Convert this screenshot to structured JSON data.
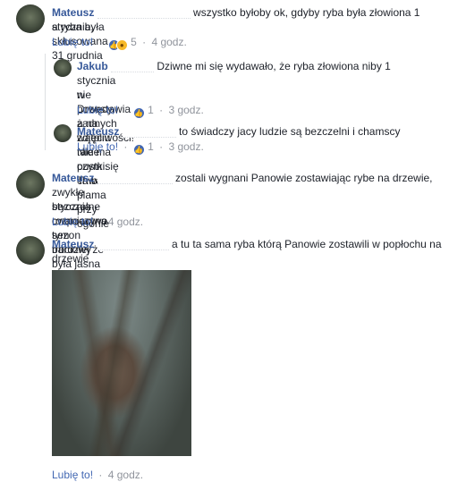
{
  "comments": [
    {
      "author": "Mateusz",
      "text_line1": "wszystko byłoby ok, gdyby ryba była złowiona 1 stycznia,",
      "text_line2": "a ryba była skłusowana 31 grudnia",
      "like_label": "Lubię to!",
      "reaction_count": "5",
      "time": "4 godz."
    },
    {
      "author": "Jakub",
      "text_line1": "Dziwne mi się wydawało, że ryba złowiona niby 1",
      "text_line2": "stycznia w Drwęcy, a na zdjęciu takie pustki. Ta biała plama przy ogonie",
      "text_line3": "nie pozostawia żadnych wątpliwości! Nie ma czym się chwalić!",
      "like_label": "Lubię to!",
      "reaction_count": "1",
      "time": "3 godz."
    },
    {
      "author": "Mateusz",
      "text_line1": "to świadczy jacy ludzie są bezczelni i chamscy",
      "like_label": "Lubię to!",
      "reaction_count": "1",
      "time": "3 godz."
    },
    {
      "author": "Mateusz",
      "text_line1": "zostali wygnani Panowie zostawiając rybe na drzewie,",
      "text_line2": "zwykłe bezczelne cwaniactwo tym bardziej że była jasna informacja że 1",
      "text_line3": "stycznia rozpoczyna sezon trociowy",
      "like_label": "Lubię to!",
      "time": "4 godz."
    },
    {
      "author": "Mateusz",
      "text_line1": "a tu ta sama ryba którą Panowie zostawili w popłochu na",
      "text_line2": "drzewie",
      "like_label": "Lubię to!",
      "time": "4 godz."
    }
  ],
  "separator": "·",
  "icons": [
    "like-reaction-icon",
    "wow-reaction-icon",
    "avatar"
  ],
  "colors": {
    "author": "#365899",
    "link": "#4267b2",
    "meta": "#90949c",
    "text": "#1d2129"
  }
}
